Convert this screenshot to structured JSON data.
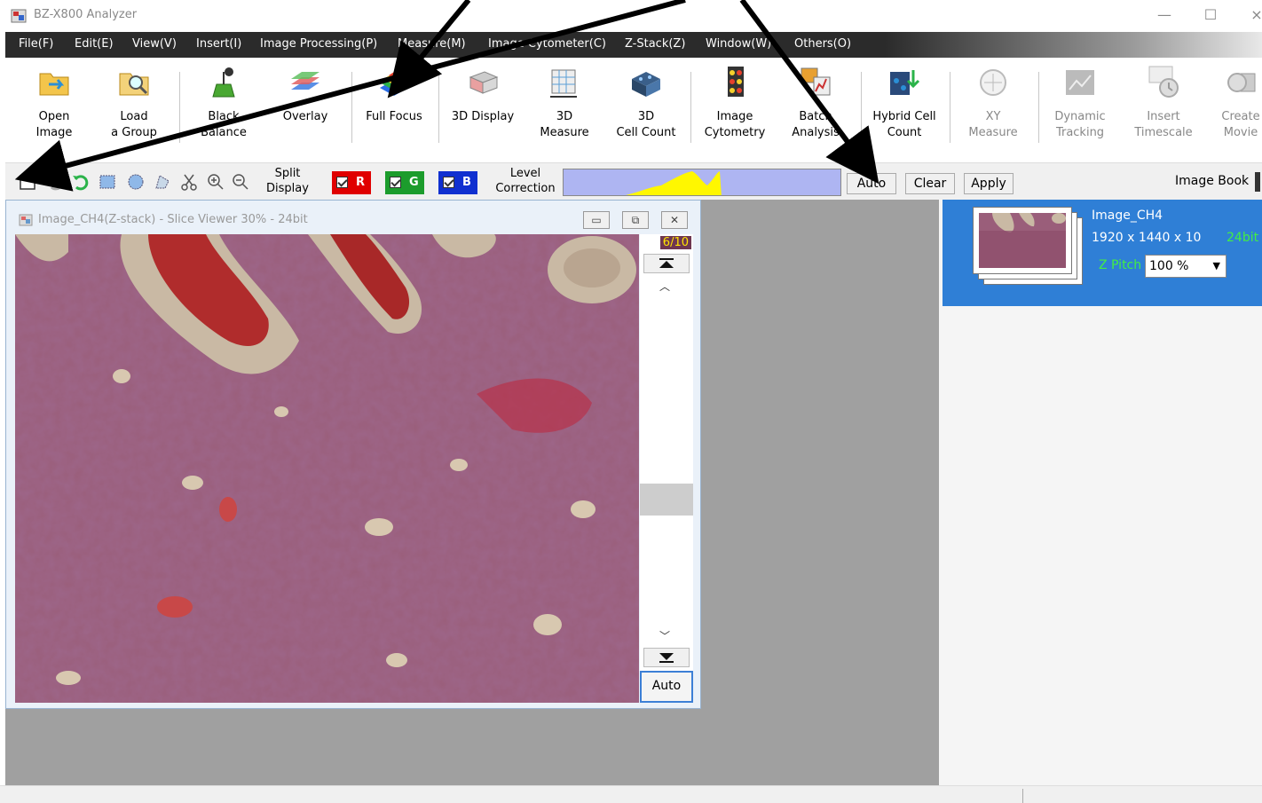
{
  "window": {
    "title": "BZ-X800 Analyzer",
    "controls": {
      "minimize": "—",
      "maximize": "☐",
      "close": "×"
    }
  },
  "menu": [
    "File(F)",
    "Edit(E)",
    "View(V)",
    "Insert(I)",
    "Image Processing(P)",
    "Measure(M)",
    "Image Cytometer(C)",
    "Z-Stack(Z)",
    "Window(W)",
    "Others(O)"
  ],
  "ribbon": [
    {
      "label": "Open\nImage",
      "icon": "open-folder-icon"
    },
    {
      "label": "Load\na Group",
      "icon": "load-group-icon"
    },
    {
      "label": "Black\nBalance",
      "icon": "black-balance-icon"
    },
    {
      "label": "Overlay",
      "icon": "overlay-icon"
    },
    {
      "label": "Full Focus",
      "icon": "full-focus-icon"
    },
    {
      "label": "3D Display",
      "icon": "3d-display-icon"
    },
    {
      "label": "3D\nMeasure",
      "icon": "3d-measure-icon"
    },
    {
      "label": "3D\nCell Count",
      "icon": "3d-cell-count-icon"
    },
    {
      "label": "Image\nCytometry",
      "icon": "image-cytometry-icon"
    },
    {
      "label": "Batch\nAnalysis",
      "icon": "batch-analysis-icon"
    },
    {
      "label": "Hybrid Cell\nCount",
      "icon": "hybrid-cell-count-icon"
    },
    {
      "label": "XY\nMeasure",
      "icon": "xy-measure-icon"
    },
    {
      "label": "Dynamic\nTracking",
      "icon": "dynamic-tracking-icon"
    },
    {
      "label": "Insert\nTimescale",
      "icon": "insert-timescale-icon"
    },
    {
      "label": "Create\nMovie",
      "icon": "create-movie-icon"
    }
  ],
  "toolbar": {
    "split_display": "Split\nDisplay",
    "channels": [
      {
        "label": "R",
        "color": "#e00000"
      },
      {
        "label": "G",
        "color": "#1c9c2c"
      },
      {
        "label": "B",
        "color": "#1030d0"
      }
    ],
    "level_correction": "Level\nCorrection",
    "auto": "Auto",
    "clear": "Clear",
    "apply": "Apply",
    "image_book": "Image Book"
  },
  "viewer": {
    "title": "Image_CH4(Z-stack) - Slice Viewer 30% - 24bit",
    "slice_indicator": "6/10",
    "auto": "Auto",
    "slice_position": 0.55
  },
  "image_book": {
    "name": "Image_CH4",
    "dimensions": "1920 x 1440 x 10",
    "bit_depth": "24bit",
    "z_pitch_label": "Z Pitch",
    "z_pitch_value": "100 %"
  },
  "colors": {
    "accent": "#2f7fd6",
    "menubar": "#2b2b2b",
    "histogram_bg": "#aeb5f2",
    "histogram_fill": "#fff700"
  }
}
